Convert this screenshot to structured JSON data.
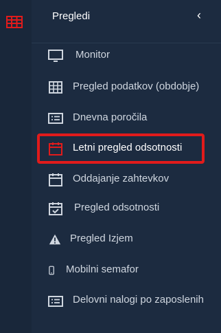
{
  "app": {
    "rail_icon": "table-grid-icon",
    "accent": "#e11b1b"
  },
  "sidebar": {
    "title": "Pregledi",
    "collapse_icon": "chevron-left-icon",
    "items": [
      {
        "label": "Monitor",
        "icon": "monitor-icon"
      },
      {
        "label": "Pregled podatkov (obdobje)",
        "icon": "table-icon"
      },
      {
        "label": "Dnevna poročila",
        "icon": "list-card-icon"
      },
      {
        "label": "Letni pregled odsotnosti",
        "icon": "calendar-icon",
        "active": true
      },
      {
        "label": "Oddajanje zahtevkov",
        "icon": "calendar-icon"
      },
      {
        "label": "Pregled odsotnosti",
        "icon": "calendar-check-icon"
      },
      {
        "label": "Pregled Izjem",
        "icon": "warning-icon"
      },
      {
        "label": "Mobilni semafor",
        "icon": "mobile-icon"
      },
      {
        "label": "Delovni nalogi po zaposlenih",
        "icon": "list-card-icon"
      }
    ]
  }
}
